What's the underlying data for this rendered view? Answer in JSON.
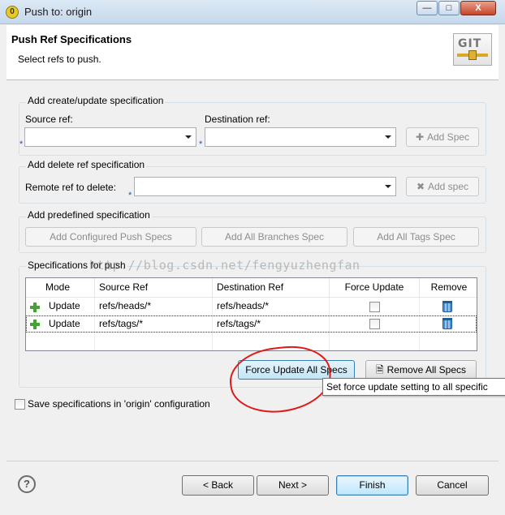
{
  "window": {
    "title": "Push to: origin",
    "min_glyph": "—",
    "max_glyph": "□",
    "close_glyph": "X"
  },
  "banner": {
    "title": "Push Ref Specifications",
    "subtitle": "Select refs to push.",
    "logo_text": "GIT"
  },
  "create_group": {
    "label": "Add create/update specification",
    "source_label": "Source ref:",
    "dest_label": "Destination ref:",
    "add_button": "Add Spec",
    "required_marker": "*"
  },
  "delete_group": {
    "label": "Add delete ref specification",
    "remote_label": "Remote ref to delete:",
    "add_button": "Add spec",
    "required_marker": "*"
  },
  "predefined_group": {
    "label": "Add predefined specification",
    "buttons": [
      "Add Configured Push Specs",
      "Add All Branches Spec",
      "Add All Tags Spec"
    ]
  },
  "specs_group": {
    "label": "Specifications for push",
    "columns": [
      "Mode",
      "Source Ref",
      "Destination Ref",
      "Force Update",
      "Remove"
    ],
    "rows": [
      {
        "mode": "Update",
        "source": "refs/heads/*",
        "dest": "refs/heads/*",
        "force": false
      },
      {
        "mode": "Update",
        "source": "refs/tags/*",
        "dest": "refs/tags/*",
        "force": false
      }
    ]
  },
  "watermark": "http://blog.csdn.net/fengyuzhengfan",
  "actions": {
    "force_all": "Force Update All Specs",
    "remove_all": "Remove All Specs",
    "tooltip": "Set force update setting to all specific"
  },
  "save_option": {
    "label": "Save specifications in 'origin' configuration",
    "checked": false
  },
  "footer": {
    "help_glyph": "?",
    "back": "< Back",
    "next": "Next >",
    "finish": "Finish",
    "cancel": "Cancel"
  },
  "colors": {
    "annotation_circle": "#e01818",
    "add_icon": "#44a332",
    "remove_icon": "#4b8fd0"
  }
}
